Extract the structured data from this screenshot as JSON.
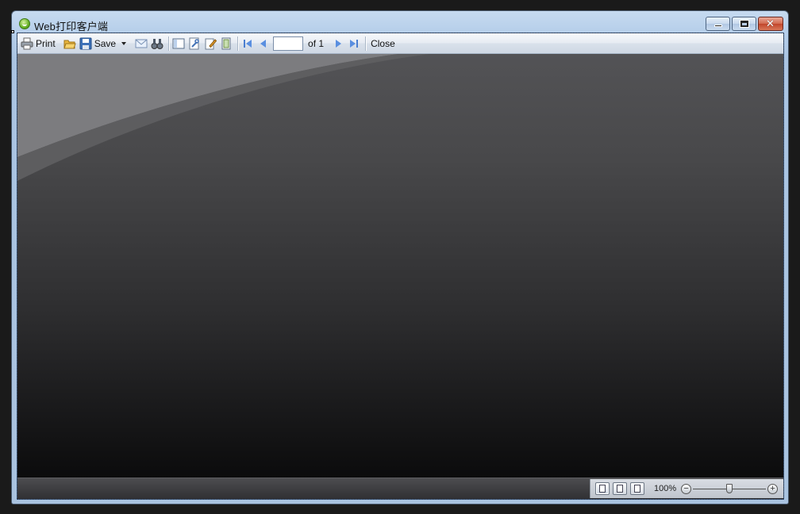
{
  "window": {
    "title": "Web打印客户端"
  },
  "toolbar": {
    "print_label": "Print",
    "save_label": "Save",
    "page_value": "",
    "page_of_label": "of 1",
    "close_label": "Close"
  },
  "statusbar": {
    "zoom_label": "100%",
    "zoom_percent": 100,
    "zoom_slider_fraction": 0.5
  },
  "colors": {
    "accent": "#3f6aa4",
    "close_button": "#c1452b"
  },
  "icons": {
    "app": "printer-client-icon",
    "print": "printer-icon",
    "open": "folder-open-icon",
    "save": "floppy-disk-icon",
    "save_menu": "chevron-down-icon",
    "email": "envelope-icon",
    "find": "binoculars-icon",
    "toc": "document-map-icon",
    "parameters": "wrench-icon",
    "edit": "pencil-page-icon",
    "page_setup": "page-setup-icon",
    "first": "first-page-icon",
    "prev": "previous-page-icon",
    "next": "next-page-icon",
    "last": "last-page-icon"
  }
}
